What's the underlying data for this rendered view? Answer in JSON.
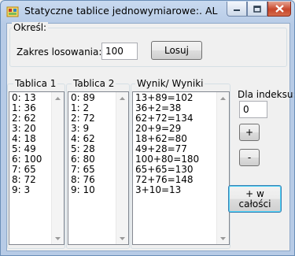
{
  "window": {
    "title": "Statyczne tablice jednowymiarowe:. AL"
  },
  "top_group": {
    "label": "Określ:",
    "range_label": "Zakres losowania:",
    "range_value": "100",
    "draw_button": "Losuj"
  },
  "lists": {
    "tablica1": {
      "label": "Tablica 1",
      "items": [
        "0: 13",
        "1: 36",
        "2: 62",
        "3: 20",
        "4: 18",
        "5: 49",
        "6: 100",
        "7: 65",
        "8: 72",
        "9: 3"
      ]
    },
    "tablica2": {
      "label": "Tablica 2",
      "items": [
        "0: 89",
        "1: 2",
        "2: 72",
        "3: 9",
        "4: 62",
        "5: 28",
        "6: 80",
        "7: 65",
        "8: 76",
        "9: 10"
      ]
    },
    "wyniki": {
      "label": "Wynik/ Wyniki",
      "items": [
        "13+89=102",
        "36+2=38",
        "62+72=134",
        "20+9=29",
        "18+62=80",
        "49+28=77",
        "100+80=180",
        "65+65=130",
        "72+76=148",
        "3+10=13"
      ]
    }
  },
  "index_panel": {
    "label": "Dla indeksu:",
    "value": "0",
    "plus_button": "+",
    "minus_button": "-",
    "whole_button_line1": "+ w",
    "whole_button_line2": "całości"
  }
}
